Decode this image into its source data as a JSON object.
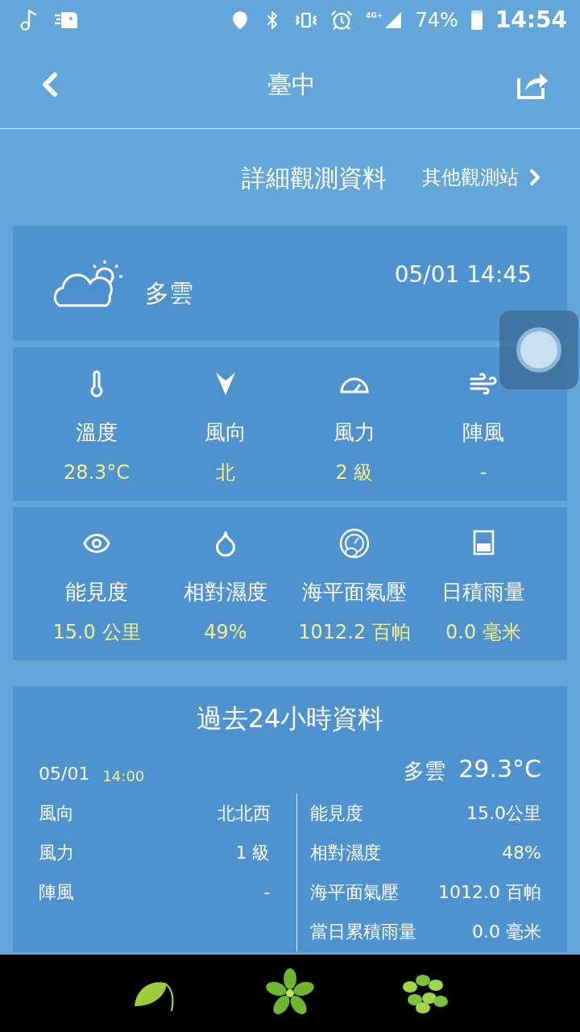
{
  "status_bar": {
    "network": "4G+",
    "battery": "74%",
    "time": "14:54"
  },
  "header": {
    "title": "臺中"
  },
  "section": {
    "title": "詳細觀測資料",
    "link": "其他觀測站"
  },
  "current": {
    "weather": "多雲",
    "datetime": "05/01 14:45"
  },
  "stat_rows": [
    [
      {
        "kind": "thermometer",
        "label": "溫度",
        "value": "28.3°C"
      },
      {
        "kind": "direction",
        "label": "風向",
        "value": "北"
      },
      {
        "kind": "gauge",
        "label": "風力",
        "value": "2 級"
      },
      {
        "kind": "wind",
        "label": "陣風",
        "value": "-"
      }
    ],
    [
      {
        "kind": "eye",
        "label": "能見度",
        "value": "15.0 公里"
      },
      {
        "kind": "drop",
        "label": "相對濕度",
        "value": "49%"
      },
      {
        "kind": "barometer",
        "label": "海平面氣壓",
        "value": "1012.2 百帕"
      },
      {
        "kind": "beaker",
        "label": "日積雨量",
        "value": "0.0 毫米"
      }
    ]
  ],
  "past": {
    "title": "過去24小時資料",
    "date": "05/01",
    "time": "14:00",
    "weather": "多雲",
    "temperature": "29.3°C",
    "left": [
      {
        "label": "風向",
        "value": "北北西"
      },
      {
        "label": "風力",
        "value": "1 級"
      },
      {
        "label": "陣風",
        "value": "-"
      }
    ],
    "right": [
      {
        "label": "能見度",
        "value": "15.0公里"
      },
      {
        "label": "相對濕度",
        "value": "48%"
      },
      {
        "label": "海平面氣壓",
        "value": "1012.0 百帕"
      },
      {
        "label": "當日累積雨量",
        "value": "0.0 毫米"
      }
    ]
  },
  "bottom_nav": [
    {
      "kind": "leaf"
    },
    {
      "kind": "wreath"
    },
    {
      "kind": "cluster"
    }
  ]
}
